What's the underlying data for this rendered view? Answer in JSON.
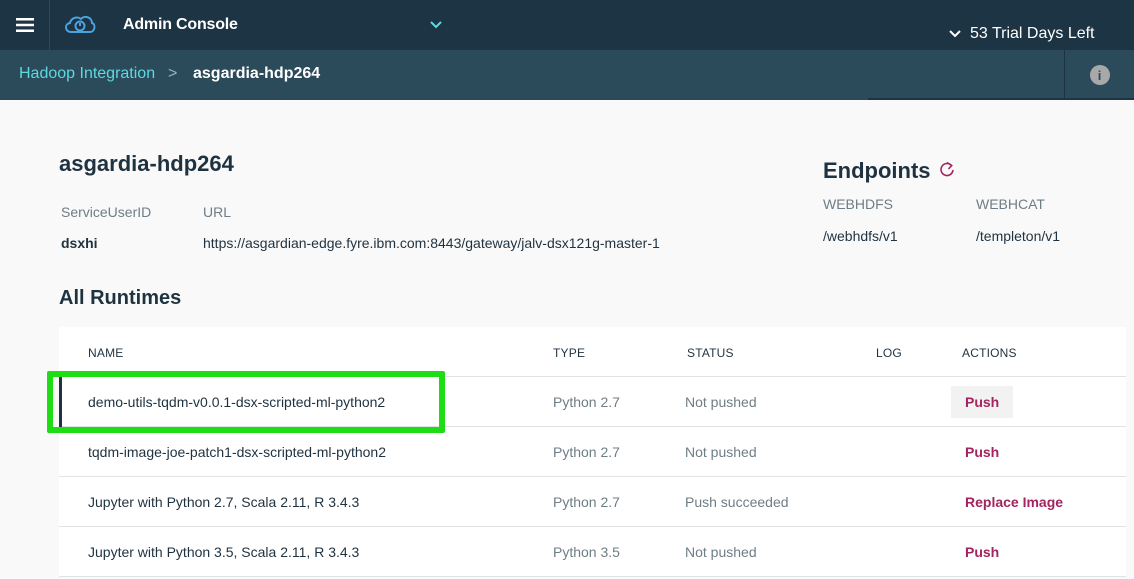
{
  "topbar": {
    "app_title": "Admin Console",
    "trial": "53 Trial Days Left",
    "icons": [
      "menu-icon",
      "cloud-logo-icon",
      "chevron-down-icon"
    ]
  },
  "breadcrumb": {
    "parent": "Hadoop Integration",
    "separator": ">",
    "current": "asgardia-hdp264",
    "info": "i"
  },
  "detail": {
    "title": "asgardia-hdp264",
    "service_user_label": "ServiceUserID",
    "service_user_value": "dsxhi",
    "url_label": "URL",
    "url_value": "https://asgardian-edge.fyre.ibm.com:8443/gateway/jalv-dsx121g-master-1"
  },
  "endpoints": {
    "title": "Endpoints",
    "webhdfs_label": "WEBHDFS",
    "webhdfs_value": "/webhdfs/v1",
    "webhcat_label": "WEBHCAT",
    "webhcat_value": "/templeton/v1"
  },
  "runtimes": {
    "title": "All Runtimes",
    "columns": {
      "name": "NAME",
      "type": "TYPE",
      "status": "STATUS",
      "log": "LOG",
      "actions": "ACTIONS"
    },
    "rows": [
      {
        "name": "demo-utils-tqdm-v0.0.1-dsx-scripted-ml-python2",
        "type": "Python 2.7",
        "status": "Not pushed",
        "action": "Push"
      },
      {
        "name": "tqdm-image-joe-patch1-dsx-scripted-ml-python2",
        "type": "Python 2.7",
        "status": "Not pushed",
        "action": "Push"
      },
      {
        "name": "Jupyter with Python 2.7, Scala 2.11, R 3.4.3",
        "type": "Python 2.7",
        "status": "Push succeeded",
        "action": "Replace Image"
      },
      {
        "name": "Jupyter with Python 3.5, Scala 2.11, R 3.4.3",
        "type": "Python 3.5",
        "status": "Not pushed",
        "action": "Push"
      }
    ]
  },
  "colors": {
    "topbar": "#1c3443",
    "crumbbar": "#2b4a5a",
    "link": "#5ed9e0",
    "action": "#a3245f",
    "highlight": "#1fdd14"
  }
}
